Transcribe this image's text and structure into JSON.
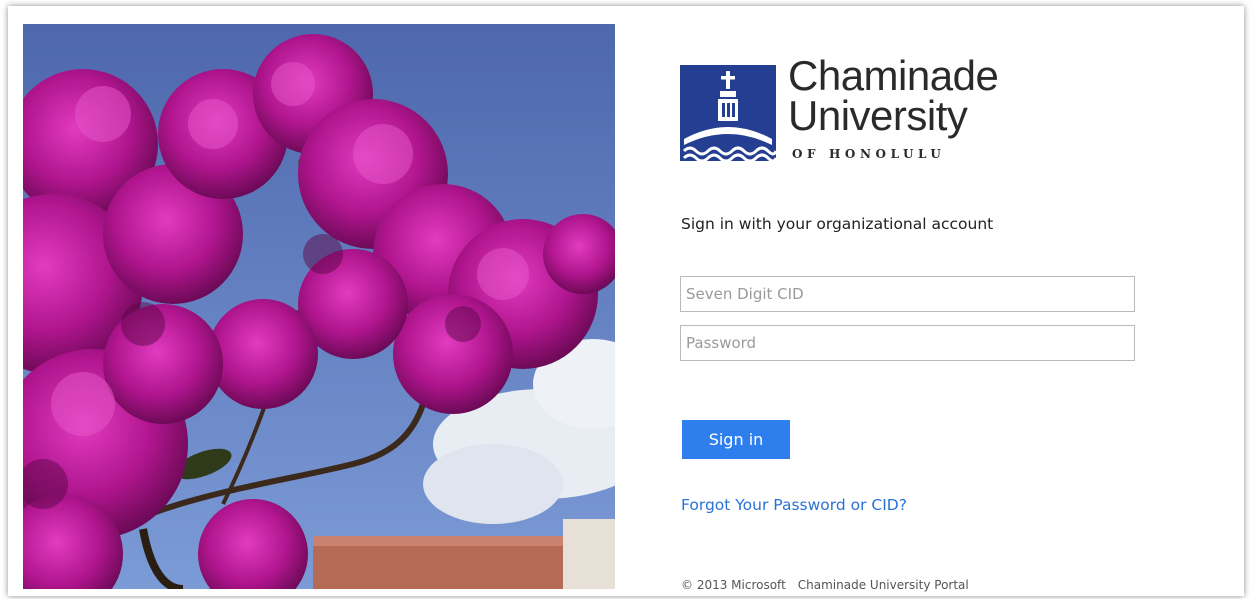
{
  "org": {
    "name_line1": "Chaminade",
    "name_line2": "University",
    "subtitle": "OF HONOLULU",
    "brand_color": "#243e91"
  },
  "signin": {
    "heading": "Sign in with your organizational account",
    "username_placeholder": "Seven Digit CID",
    "password_placeholder": "Password",
    "button_label": "Sign in",
    "forgot_link": "Forgot Your Password or CID?",
    "button_color": "#2f7eee",
    "link_color": "#2a72d6"
  },
  "footer": {
    "copyright": "© 2013 Microsoft",
    "portal_name": "Chaminade University Portal"
  },
  "illustration": {
    "subject": "bougainvillea-flowers-photo",
    "flower_color": "#b4148c",
    "sky_color": "#5e7fc4"
  }
}
